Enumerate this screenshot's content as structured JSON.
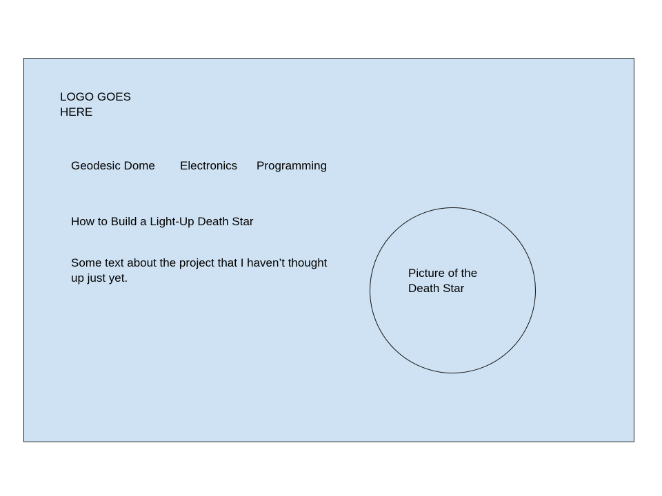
{
  "logo": {
    "text": "LOGO GOES\nHERE"
  },
  "nav": {
    "items": [
      {
        "label": "Geodesic Dome"
      },
      {
        "label": "Electronics"
      },
      {
        "label": "Programming"
      }
    ]
  },
  "main": {
    "title": "How to Build a Light-Up Death Star",
    "description": "Some text about the project that I haven’t thought up just yet."
  },
  "picture": {
    "label": "Picture of the Death Star"
  },
  "colors": {
    "panel_background": "#cfe2f3",
    "border": "#222222",
    "text": "#000000"
  }
}
